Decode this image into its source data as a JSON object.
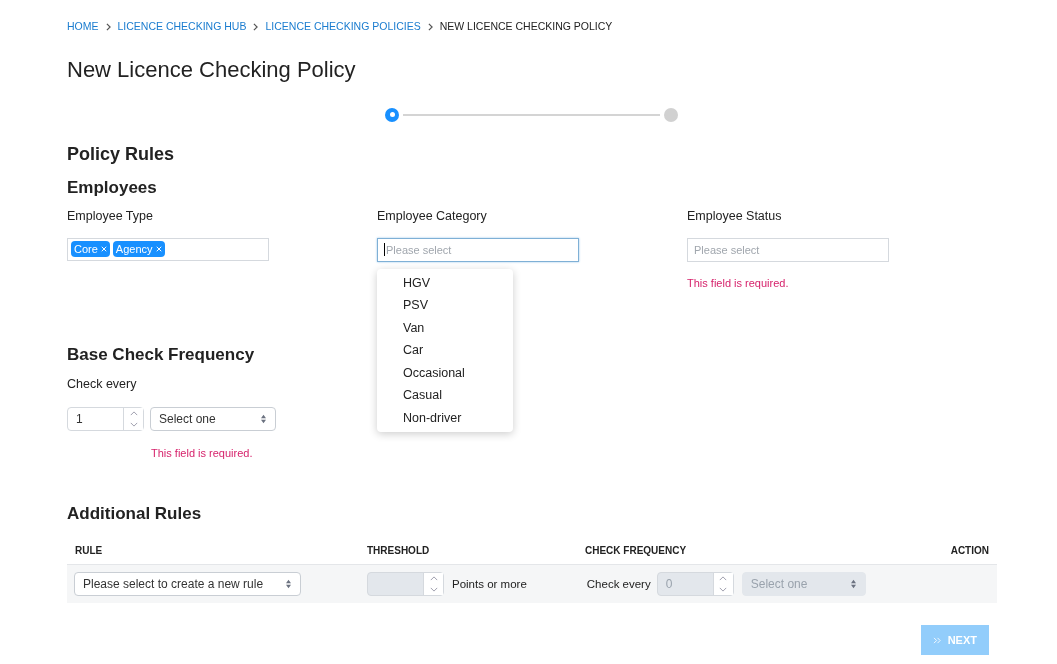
{
  "breadcrumb": [
    {
      "label": "HOME",
      "link": true
    },
    {
      "label": "LICENCE CHECKING HUB",
      "link": true
    },
    {
      "label": "LICENCE CHECKING POLICIES",
      "link": true
    },
    {
      "label": "NEW LICENCE CHECKING POLICY",
      "link": false
    }
  ],
  "title": "New Licence Checking Policy",
  "steps": [
    {
      "selected": true
    },
    {
      "selected": false
    }
  ],
  "section_title": "Policy Rules",
  "employees": {
    "title": "Employees",
    "fields": [
      {
        "label": "Employee Type",
        "kind": "tags",
        "tags": [
          "Core",
          "Agency"
        ]
      },
      {
        "label": "Employee Category",
        "kind": "select",
        "placeholder": "Please select",
        "focused": true,
        "options": [
          "HGV",
          "PSV",
          "Van",
          "Car",
          "Occasional",
          "Casual",
          "Non-driver"
        ]
      },
      {
        "label": "Employee Status",
        "kind": "select",
        "placeholder": "Please select",
        "focused": false,
        "error": "This field is required."
      }
    ]
  },
  "base_check": {
    "title": "Base Check Frequency",
    "label": "Check every",
    "number": "1",
    "select": "Select one",
    "error": "This field is required."
  },
  "additional_rules": {
    "title": "Additional Rules",
    "columns": [
      "RULE",
      "THRESHOLD",
      "CHECK FREQUENCY",
      "ACTION"
    ],
    "row": {
      "rule": "Please select to create a new rule",
      "threshold_disabled": true,
      "threshold_suffix": "Points or more",
      "frequency_label": "Check every",
      "frequency_number": "0",
      "frequency_disabled": true,
      "frequency_select": "Select one"
    }
  },
  "next_button": {
    "label": "NEXT",
    "disabled": true
  }
}
